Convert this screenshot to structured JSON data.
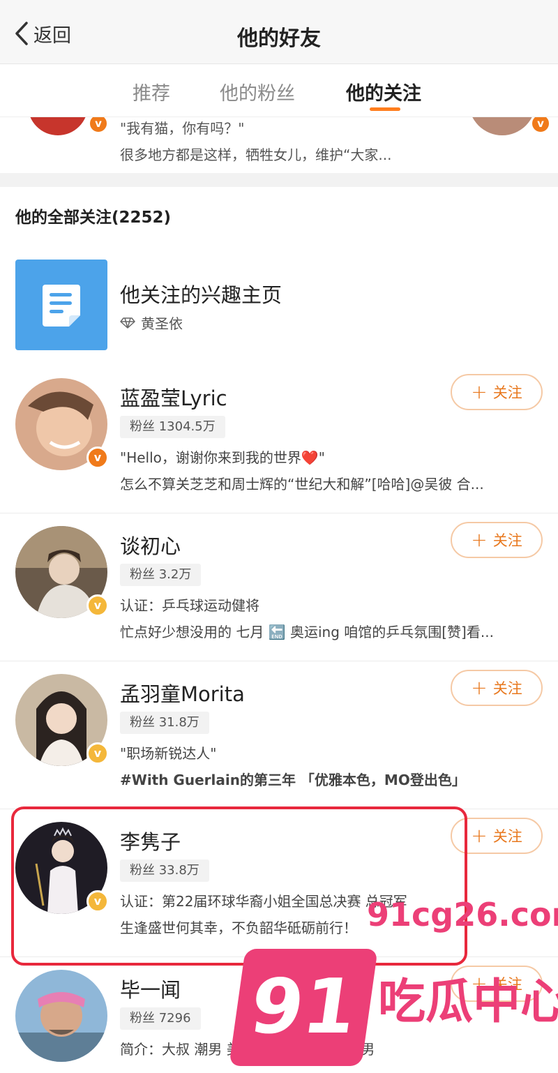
{
  "nav": {
    "back_label": "返回",
    "title": "他的好友"
  },
  "tabs": [
    {
      "label": "推荐",
      "active": false
    },
    {
      "label": "他的粉丝",
      "active": false
    },
    {
      "label": "他的关注",
      "active": true
    }
  ],
  "snippet": {
    "line1": "\"我有猫，你有吗？\"",
    "line2": "很多地方都是这样，牺牲女儿，维护“大家..."
  },
  "section_title": "他的全部关注(2252)",
  "interest": {
    "name": "他关注的兴趣主页",
    "sub": "黄圣依"
  },
  "follow_label": "关注",
  "users": [
    {
      "name": "蓝盈莹Lyric",
      "fans": "粉丝 1304.5万",
      "desc1": "\"Hello，谢谢你来到我的世界❤️\"",
      "desc2": "怎么不算关芝芝和周士辉的“世纪大和解”[哈哈]@吴彼 合...",
      "badge": "orange"
    },
    {
      "name": "谈初心",
      "fans": "粉丝 3.2万",
      "desc1": "认证：乒乓球运动健将",
      "desc2": "忙点好少想没用的 七月 🔚 奥运ing 咱馆的乒乓氛围[赞]看...",
      "badge": "gold"
    },
    {
      "name": "孟羽童Morita",
      "fans": "粉丝 31.8万",
      "desc1": "\"职场新锐达人\"",
      "desc2": "#With Guerlain的第三年 「优雅本色，MO登出色」",
      "badge": "gold"
    },
    {
      "name": "李隽子",
      "fans": "粉丝 33.8万",
      "desc1": "认证：第22届环球华裔小姐全国总决赛 总冠军",
      "desc2": "生逢盛世何其幸，不负韶华砥砺前行！",
      "badge": "gold"
    },
    {
      "name": "毕一闻",
      "fans": "粉丝 7296",
      "desc1": "简介：大叔 潮男 美食家 时尚厨子 运动男",
      "desc2": "",
      "badge": "none"
    }
  ],
  "watermark": {
    "url": "91cg26.com",
    "number": "91",
    "text": "吃瓜中心"
  },
  "colors": {
    "accent": "#ff7e1e",
    "follow": "#e8781e",
    "highlight": "#e8283c",
    "watermark": "#ec3f77"
  }
}
